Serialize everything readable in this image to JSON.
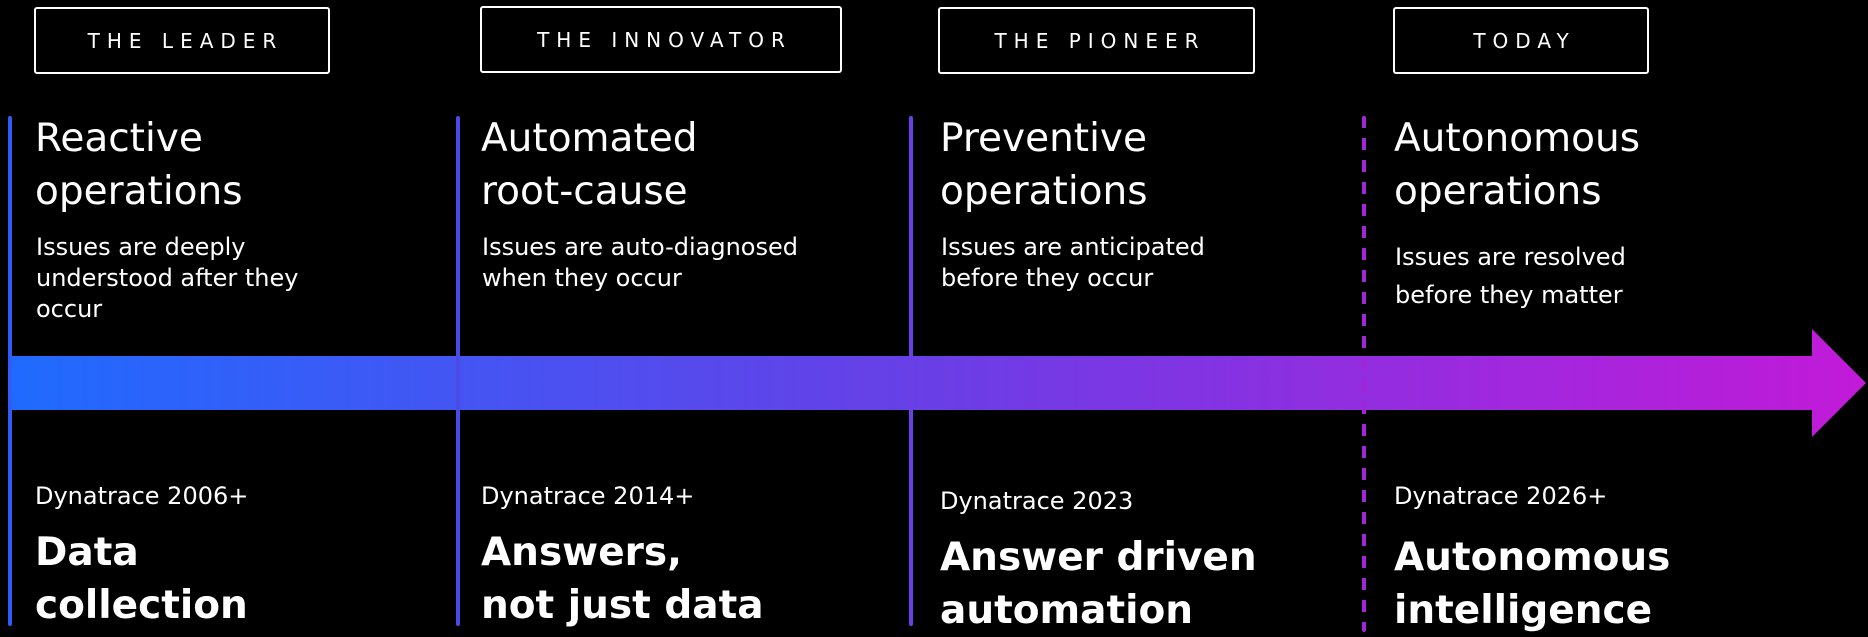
{
  "colors": {
    "background": "#000000",
    "text": "#ffffff",
    "arrow_start": "#1f6bff",
    "arrow_mid": "#6a3ee6",
    "arrow_end": "#c21ad8",
    "line_1": "#2f5cf2",
    "line_2": "#4a4ae8",
    "line_3": "#6b3fe6",
    "line_4_dashed": "#a226d9"
  },
  "stages": [
    {
      "badge": "THE LEADER",
      "title": "Reactive\noperations",
      "description": "Issues are deeply\nunderstood after they\noccur",
      "year": "Dynatrace 2006+",
      "outcome": "Data\ncollection"
    },
    {
      "badge": "THE INNOVATOR",
      "title": "Automated\nroot-cause",
      "description": "Issues are auto-diagnosed\nwhen they occur",
      "year": "Dynatrace 2014+",
      "outcome": "Answers,\nnot just data"
    },
    {
      "badge": "THE PIONEER",
      "title": "Preventive\noperations",
      "description": "Issues are anticipated\nbefore they occur",
      "year": "Dynatrace 2023",
      "outcome": "Answer driven\nautomation"
    },
    {
      "badge": "TODAY",
      "title": "Autonomous\noperations",
      "description": "Issues are resolved\nbefore they matter",
      "year": "Dynatrace 2026+",
      "outcome": "Autonomous\nintelligence"
    }
  ]
}
